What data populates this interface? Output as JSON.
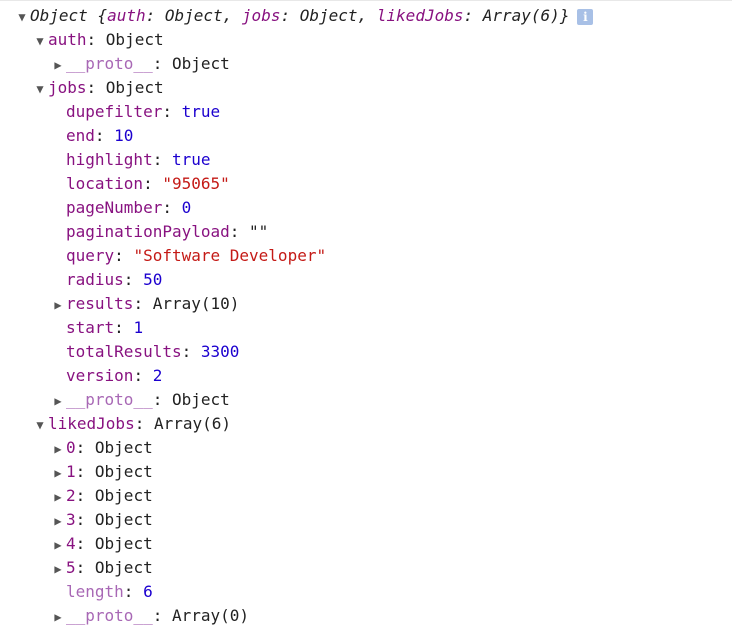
{
  "root": {
    "summary_prefix": "Object {",
    "summary_auth_key": "auth",
    "summary_auth_val": "Object",
    "summary_jobs_key": "jobs",
    "summary_jobs_val": "Object",
    "summary_liked_key": "likedJobs",
    "summary_liked_val": "Array(6)",
    "summary_suffix": "}",
    "info_glyph": "i"
  },
  "auth": {
    "key": "auth",
    "value": "Object",
    "proto_key": "__proto__",
    "proto_val": "Object"
  },
  "jobs": {
    "key": "jobs",
    "value": "Object",
    "props": [
      {
        "key": "dupefilter",
        "value": "true"
      },
      {
        "key": "end",
        "value": "10"
      },
      {
        "key": "highlight",
        "value": "true"
      },
      {
        "key": "location",
        "value": "\"95065\""
      },
      {
        "key": "pageNumber",
        "value": "0"
      },
      {
        "key": "paginationPayload",
        "value": "\"\""
      },
      {
        "key": "query",
        "value": "\"Software Developer\""
      },
      {
        "key": "radius",
        "value": "50"
      },
      {
        "key": "results",
        "value": "Array(10)"
      },
      {
        "key": "start",
        "value": "1"
      },
      {
        "key": "totalResults",
        "value": "3300"
      },
      {
        "key": "version",
        "value": "2"
      }
    ],
    "proto_key": "__proto__",
    "proto_val": "Object"
  },
  "likedJobs": {
    "key": "likedJobs",
    "value": "Array(6)",
    "items": [
      {
        "key": "0",
        "value": "Object"
      },
      {
        "key": "1",
        "value": "Object"
      },
      {
        "key": "2",
        "value": "Object"
      },
      {
        "key": "3",
        "value": "Object"
      },
      {
        "key": "4",
        "value": "Object"
      },
      {
        "key": "5",
        "value": "Object"
      }
    ],
    "length_key": "length",
    "length_val": "6",
    "proto_key": "__proto__",
    "proto_val": "Array(0)"
  },
  "colon": ": "
}
